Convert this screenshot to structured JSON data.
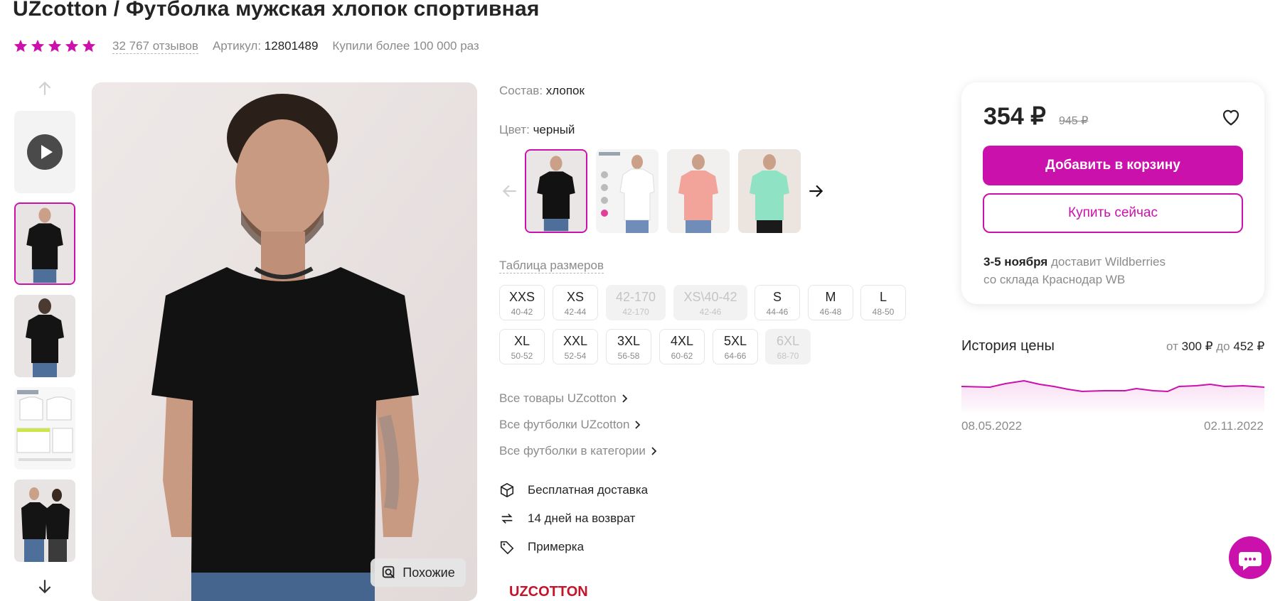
{
  "product": {
    "title": "UZcotton / Футболка мужская хлопок спортивная",
    "reviews": "32 767 отзывов",
    "article_label": "Артикул:",
    "article_value": "12801489",
    "bought": "Купили более 100 000 раз",
    "rating": 5
  },
  "gallery": {
    "similar_label": "Похожие"
  },
  "specs": {
    "composition_label": "Состав:",
    "composition_value": "хлопок",
    "color_label": "Цвет:",
    "color_value": "черный"
  },
  "sizes": {
    "table_link": "Таблица размеров",
    "items": [
      {
        "size": "XXS",
        "ru": "40-42",
        "available": true
      },
      {
        "size": "XS",
        "ru": "42-44",
        "available": true
      },
      {
        "size": "42-170",
        "ru": "42-170",
        "available": false
      },
      {
        "size": "XS\\40-42",
        "ru": "42-46",
        "available": false
      },
      {
        "size": "S",
        "ru": "44-46",
        "available": true
      },
      {
        "size": "M",
        "ru": "46-48",
        "available": true
      },
      {
        "size": "L",
        "ru": "48-50",
        "available": true
      },
      {
        "size": "XL",
        "ru": "50-52",
        "available": true
      },
      {
        "size": "XXL",
        "ru": "52-54",
        "available": true
      },
      {
        "size": "3XL",
        "ru": "56-58",
        "available": true
      },
      {
        "size": "4XL",
        "ru": "60-62",
        "available": true
      },
      {
        "size": "5XL",
        "ru": "64-66",
        "available": true
      },
      {
        "size": "6XL",
        "ru": "68-70",
        "available": false
      }
    ]
  },
  "links": {
    "all_brand": "Все товары UZcotton",
    "all_tshirts_brand": "Все футболки UZcotton",
    "all_tshirts_category": "Все футболки в категории"
  },
  "features": {
    "free_delivery": "Бесплатная доставка",
    "returns": "14 дней на возврат",
    "fitting": "Примерка"
  },
  "brand_logo": "UZCOTTON",
  "price_card": {
    "price": "354 ₽",
    "old_price": "945 ₽",
    "add_to_cart": "Добавить в корзину",
    "buy_now": "Купить сейчас",
    "delivery_date": "3-5 ноября",
    "delivery_by": "доставит Wildberries",
    "delivery_from": "со склада Краснодар WB"
  },
  "price_history": {
    "title": "История цены",
    "from_label": "от",
    "from_value": "300 ₽",
    "to_label": "до",
    "to_value": "452 ₽",
    "date_start": "08.05.2022",
    "date_end": "02.11.2022"
  },
  "colors": {
    "accent": "#cb11ab",
    "text": "#242424",
    "muted": "#8b8b8b"
  }
}
